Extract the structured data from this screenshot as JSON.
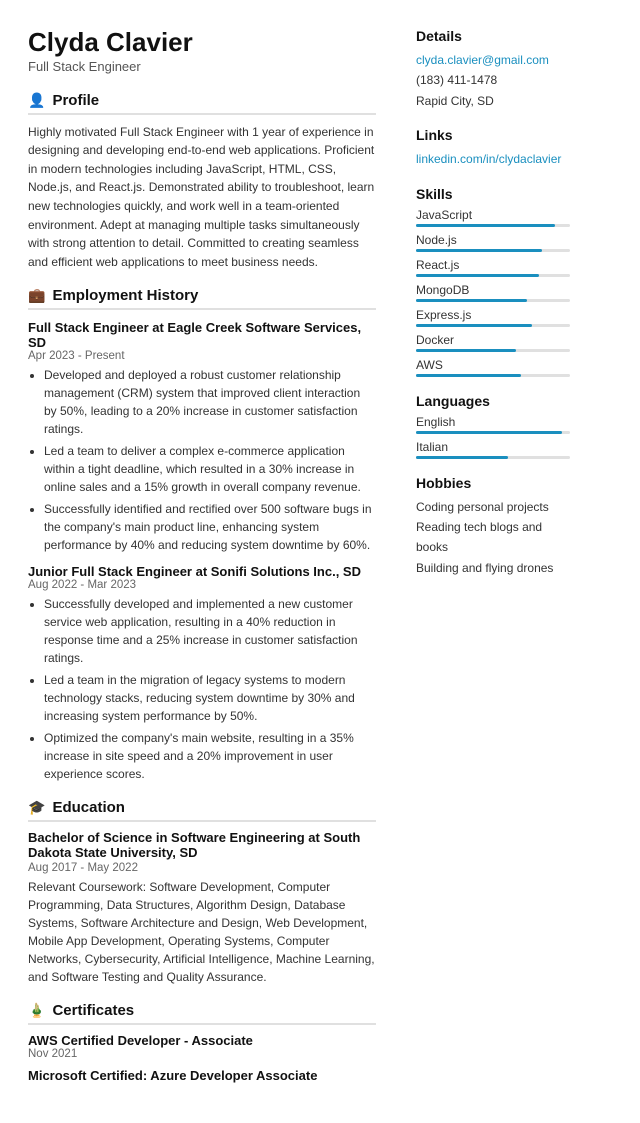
{
  "header": {
    "name": "Clyda Clavier",
    "title": "Full Stack Engineer"
  },
  "profile": {
    "section_label": "Profile",
    "icon": "👤",
    "text": "Highly motivated Full Stack Engineer with 1 year of experience in designing and developing end-to-end web applications. Proficient in modern technologies including JavaScript, HTML, CSS, Node.js, and React.js. Demonstrated ability to troubleshoot, learn new technologies quickly, and work well in a team-oriented environment. Adept at managing multiple tasks simultaneously with strong attention to detail. Committed to creating seamless and efficient web applications to meet business needs."
  },
  "employment": {
    "section_label": "Employment History",
    "icon": "💼",
    "jobs": [
      {
        "title": "Full Stack Engineer at Eagle Creek Software Services, SD",
        "dates": "Apr 2023 - Present",
        "bullets": [
          "Developed and deployed a robust customer relationship management (CRM) system that improved client interaction by 50%, leading to a 20% increase in customer satisfaction ratings.",
          "Led a team to deliver a complex e-commerce application within a tight deadline, which resulted in a 30% increase in online sales and a 15% growth in overall company revenue.",
          "Successfully identified and rectified over 500 software bugs in the company's main product line, enhancing system performance by 40% and reducing system downtime by 60%."
        ]
      },
      {
        "title": "Junior Full Stack Engineer at Sonifi Solutions Inc., SD",
        "dates": "Aug 2022 - Mar 2023",
        "bullets": [
          "Successfully developed and implemented a new customer service web application, resulting in a 40% reduction in response time and a 25% increase in customer satisfaction ratings.",
          "Led a team in the migration of legacy systems to modern technology stacks, reducing system downtime by 30% and increasing system performance by 50%.",
          "Optimized the company's main website, resulting in a 35% increase in site speed and a 20% improvement in user experience scores."
        ]
      }
    ]
  },
  "education": {
    "section_label": "Education",
    "icon": "🎓",
    "degree": "Bachelor of Science in Software Engineering at South Dakota State University, SD",
    "dates": "Aug 2017 - May 2022",
    "coursework_label": "Relevant Coursework:",
    "coursework": "Software Development, Computer Programming, Data Structures, Algorithm Design, Database Systems, Software Architecture and Design, Web Development, Mobile App Development, Operating Systems, Computer Networks, Cybersecurity, Artificial Intelligence, Machine Learning, and Software Testing and Quality Assurance."
  },
  "certificates": {
    "section_label": "Certificates",
    "icon": "🏅",
    "items": [
      {
        "name": "AWS Certified Developer - Associate",
        "date": "Nov 2021"
      },
      {
        "name": "Microsoft Certified: Azure Developer Associate",
        "date": ""
      }
    ]
  },
  "details": {
    "section_label": "Details",
    "email": "clyda.clavier@gmail.com",
    "phone": "(183) 411-1478",
    "location": "Rapid City, SD"
  },
  "links": {
    "section_label": "Links",
    "linkedin": "linkedin.com/in/clydaclavier"
  },
  "skills": {
    "section_label": "Skills",
    "items": [
      {
        "name": "JavaScript",
        "pct": 90
      },
      {
        "name": "Node.js",
        "pct": 82
      },
      {
        "name": "React.js",
        "pct": 80
      },
      {
        "name": "MongoDB",
        "pct": 72
      },
      {
        "name": "Express.js",
        "pct": 75
      },
      {
        "name": "Docker",
        "pct": 65
      },
      {
        "name": "AWS",
        "pct": 68
      }
    ]
  },
  "languages": {
    "section_label": "Languages",
    "items": [
      {
        "name": "English",
        "pct": 95
      },
      {
        "name": "Italian",
        "pct": 60
      }
    ]
  },
  "hobbies": {
    "section_label": "Hobbies",
    "items": [
      "Coding personal projects",
      "Reading tech blogs and books",
      "Building and flying drones"
    ]
  }
}
